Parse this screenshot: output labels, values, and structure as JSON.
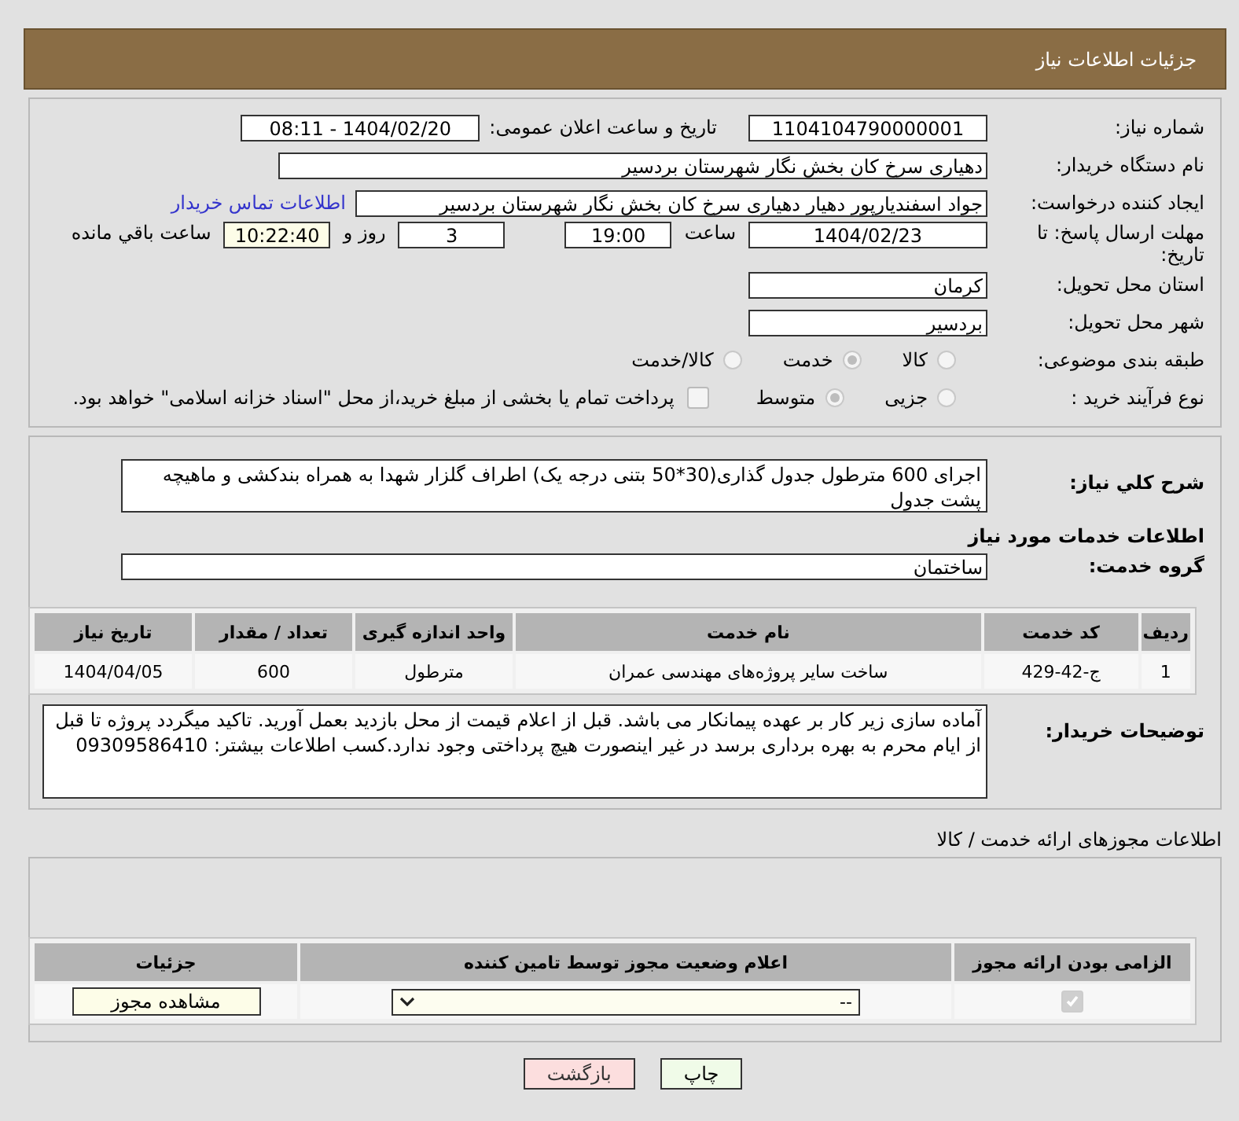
{
  "header": {
    "title": "جزئیات اطلاعات نیاز"
  },
  "details": {
    "need_number": {
      "label": "شماره نیاز:",
      "value": "1104104790000001"
    },
    "announce": {
      "label": "تاریخ و ساعت اعلان عمومی:",
      "value": "1404/02/20 - 08:11"
    },
    "buyer": {
      "label": "نام دستگاه خریدار:",
      "value": "دهیاری سرخ کان بخش نگار شهرستان بردسیر"
    },
    "creator": {
      "label": "ایجاد کننده درخواست:",
      "value": "جواد اسفندیارپور دهیار دهیاری سرخ کان بخش نگار شهرستان بردسیر",
      "link": "اطلاعات تماس خریدار"
    },
    "deadline": {
      "label": "مهلت ارسال پاسخ: تا تاریخ:",
      "date": "1404/02/23",
      "time_label": "ساعت",
      "time": "19:00",
      "days": "3",
      "days_label": "روز و",
      "remaining": "10:22:40",
      "remaining_label": "ساعت باقي مانده"
    },
    "province": {
      "label": "استان محل تحویل:",
      "value": "کرمان"
    },
    "city": {
      "label": "شهر محل تحویل:",
      "value": "بردسیر"
    },
    "category": {
      "label": "طبقه بندی موضوعی:",
      "options": [
        {
          "label": "کالا",
          "selected": false
        },
        {
          "label": "خدمت",
          "selected": true
        },
        {
          "label": "کالا/خدمت",
          "selected": false
        }
      ]
    },
    "process": {
      "label": "نوع فرآیند خرید :",
      "options": [
        {
          "label": "جزیی",
          "selected": false
        },
        {
          "label": "متوسط",
          "selected": true
        }
      ],
      "treasury": {
        "checked": false,
        "label": "پرداخت تمام یا بخشی از مبلغ خرید،از محل \"اسناد خزانه اسلامی\" خواهد بود."
      }
    }
  },
  "needs": {
    "summary_label": "شرح کلي نیاز:",
    "summary": "اجرای 600 مترطول جدول گذاری(30*50 بتنی درجه یک) اطراف گلزار شهدا به همراه بندکشی و ماهیچه پشت جدول",
    "services_title": "اطلاعات خدمات مورد نیاز",
    "group_label": "گروه خدمت:",
    "group": "ساختمان",
    "table": {
      "columns": [
        "ردیف",
        "کد خدمت",
        "نام خدمت",
        "واحد اندازه گیری",
        "تعداد / مقدار",
        "تاریخ نیاز"
      ],
      "rows": [
        [
          "1",
          "ج-42-429",
          "ساخت سایر پروژه‌های مهندسی عمران",
          "مترطول",
          "600",
          "1404/04/05"
        ]
      ]
    },
    "notes_label": "توضیحات خریدار:",
    "notes": "آماده سازی زیر کار بر عهده پیمانکار می باشد. قبل از اعلام قیمت از محل بازدید بعمل آورید. تاکید میگردد پروژه تا قبل از ایام محرم به بهره برداری برسد در غیر اینصورت هیچ پرداختی وجود ندارد.کسب اطلاعات بیشتر: 09309586410"
  },
  "permits": {
    "title": "اطلاعات مجوزهای ارائه خدمت / کالا",
    "columns": [
      "الزامی بودن ارائه مجوز",
      "اعلام وضعیت مجوز توسط تامین کننده",
      "جزئیات"
    ],
    "rows": [
      {
        "required": true,
        "status": "--",
        "button": "مشاهده مجوز"
      }
    ]
  },
  "buttons": [
    {
      "kind": "print",
      "label": "چاپ"
    },
    {
      "kind": "back",
      "label": "بازگشت"
    }
  ]
}
